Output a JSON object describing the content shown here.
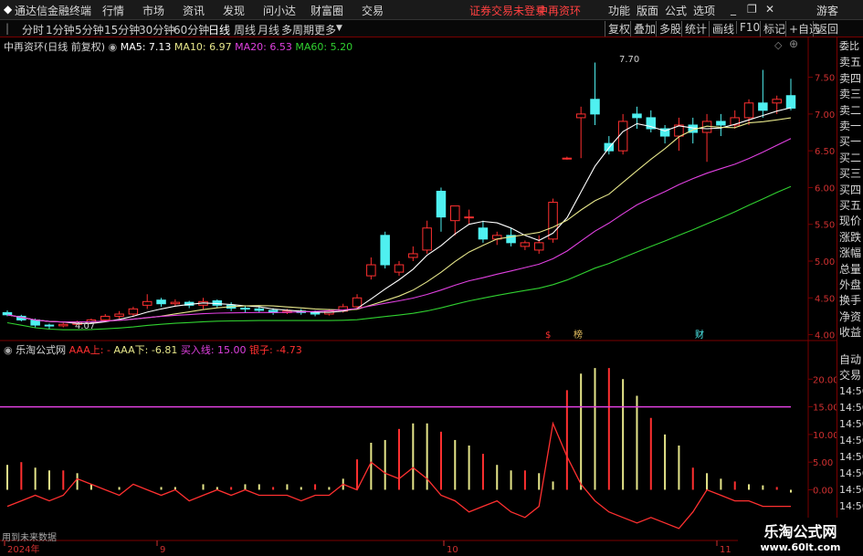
{
  "app": {
    "title": "通达信金融终端",
    "username": "游客",
    "status": "证券交易未登录",
    "stock_name": "中再资环"
  },
  "menu": [
    "行情",
    "市场",
    "资讯",
    "发现",
    "问小达",
    "财富圈",
    "交易"
  ],
  "menu_right": [
    "功能",
    "版面",
    "公式",
    "选项"
  ],
  "periods": {
    "items": [
      "分时",
      "1分钟",
      "5分钟",
      "15分钟",
      "30分钟",
      "60分钟",
      "日线",
      "周线",
      "月线",
      "多周期",
      "更多"
    ],
    "active": "日线"
  },
  "toolbar_right": [
    "复权",
    "叠加",
    "多股",
    "统计",
    "画线",
    "F10",
    "标记",
    "+自选",
    "返回"
  ],
  "main_chart": {
    "title": "中再资环(日线 前复权)",
    "ma": [
      {
        "label": "MA5: 7.13",
        "color": "#ffffff"
      },
      {
        "label": "MA10: 6.97",
        "color": "#e6e68a"
      },
      {
        "label": "MA20: 6.53",
        "color": "#e040e0"
      },
      {
        "label": "MA60: 5.20",
        "color": "#30d030"
      }
    ],
    "y_ticks": [
      "7.50",
      "7.00",
      "6.50",
      "6.00",
      "5.50",
      "5.00",
      "4.50",
      "4.00"
    ],
    "high_label": "7.70",
    "low_label": "4.07",
    "event_marks": [
      "$",
      "榜",
      "财"
    ]
  },
  "indicator": {
    "name": "乐淘公式网",
    "params": [
      {
        "label": "AAA上: -",
        "color": "#ff3030"
      },
      {
        "label": "AAA下: -6.81",
        "color": "#e6e68a"
      },
      {
        "label": "买入线: 15.00",
        "color": "#e040e0"
      },
      {
        "label": "银子: -4.73",
        "color": "#ff3030"
      }
    ],
    "y_ticks": [
      "20.00",
      "15.00",
      "10.00",
      "5.00",
      "0.00"
    ],
    "bottom_note": "用到未来数据"
  },
  "x_axis": [
    "2024年",
    "9",
    "10",
    "11"
  ],
  "right_panel": {
    "top": [
      "委比",
      "卖五",
      "卖四",
      "卖三",
      "卖二",
      "卖一",
      "买一",
      "买二",
      "买三",
      "买四",
      "买五",
      "现价",
      "涨跌",
      "涨幅",
      "总量",
      "外盘",
      "换手",
      "净资",
      "收益"
    ],
    "bottom_header": [
      "自动",
      "交易"
    ],
    "times": [
      "14:56",
      "14:56",
      "14:56",
      "14:56",
      "14:56",
      "14:56",
      "14:56",
      "14:56"
    ]
  },
  "watermark": {
    "name": "乐淘公式网",
    "url": "www.60lt.com"
  },
  "colors": {
    "up": "#ff3030",
    "down": "#4ff0f0",
    "ma5": "#ffffff",
    "ma10": "#e6e68a",
    "ma20": "#e040e0",
    "ma60": "#30d030",
    "grid": "#7a0000"
  },
  "chart_data": {
    "type": "candlestick",
    "candles": [
      [
        4.3,
        4.27,
        4.33,
        4.25
      ],
      [
        4.25,
        4.2,
        4.27,
        4.18
      ],
      [
        4.2,
        4.13,
        4.22,
        4.1
      ],
      [
        4.13,
        4.12,
        4.15,
        4.07
      ],
      [
        4.12,
        4.14,
        4.16,
        4.1
      ],
      [
        4.14,
        4.17,
        4.19,
        4.13
      ],
      [
        4.17,
        4.2,
        4.22,
        4.15
      ],
      [
        4.2,
        4.25,
        4.28,
        4.18
      ],
      [
        4.25,
        4.28,
        4.32,
        4.22
      ],
      [
        4.28,
        4.35,
        4.38,
        4.25
      ],
      [
        4.4,
        4.45,
        4.55,
        4.35
      ],
      [
        4.47,
        4.42,
        4.5,
        4.38
      ],
      [
        4.42,
        4.44,
        4.48,
        4.38
      ],
      [
        4.44,
        4.4,
        4.46,
        4.36
      ],
      [
        4.4,
        4.45,
        4.5,
        4.35
      ],
      [
        4.46,
        4.4,
        4.48,
        4.36
      ],
      [
        4.4,
        4.36,
        4.44,
        4.32
      ],
      [
        4.36,
        4.35,
        4.4,
        4.3
      ],
      [
        4.35,
        4.33,
        4.38,
        4.3
      ],
      [
        4.33,
        4.3,
        4.36,
        4.27
      ],
      [
        4.3,
        4.32,
        4.35,
        4.28
      ],
      [
        4.32,
        4.3,
        4.35,
        4.27
      ],
      [
        4.3,
        4.28,
        4.33,
        4.25
      ],
      [
        4.28,
        4.32,
        4.35,
        4.26
      ],
      [
        4.32,
        4.38,
        4.42,
        4.3
      ],
      [
        4.38,
        4.5,
        4.55,
        4.36
      ],
      [
        4.8,
        4.95,
        5.05,
        4.75
      ],
      [
        5.35,
        4.95,
        5.4,
        4.9
      ],
      [
        4.85,
        4.95,
        5.0,
        4.8
      ],
      [
        5.05,
        5.1,
        5.2,
        5.0
      ],
      [
        5.15,
        5.45,
        5.55,
        5.1
      ],
      [
        5.95,
        5.6,
        6.0,
        5.4
      ],
      [
        5.55,
        5.75,
        5.75,
        5.35
      ],
      [
        5.6,
        5.6,
        5.7,
        5.5
      ],
      [
        5.45,
        5.3,
        5.55,
        5.25
      ],
      [
        5.3,
        5.35,
        5.4,
        5.22
      ],
      [
        5.35,
        5.25,
        5.45,
        5.2
      ],
      [
        5.2,
        5.25,
        5.28,
        5.15
      ],
      [
        5.15,
        5.25,
        5.35,
        5.1
      ],
      [
        5.3,
        5.8,
        5.85,
        5.25
      ],
      [
        6.4,
        6.4,
        6.42,
        6.38
      ],
      [
        6.95,
        7.0,
        7.1,
        6.4
      ],
      [
        7.2,
        7.0,
        7.7,
        6.85
      ],
      [
        6.6,
        6.5,
        6.7,
        6.45
      ],
      [
        6.5,
        6.9,
        7.0,
        6.45
      ],
      [
        7.0,
        6.95,
        7.1,
        6.8
      ],
      [
        6.95,
        6.8,
        7.05,
        6.75
      ],
      [
        6.8,
        6.7,
        6.85,
        6.6
      ],
      [
        6.7,
        6.85,
        6.95,
        6.5
      ],
      [
        6.85,
        6.75,
        6.95,
        6.6
      ],
      [
        6.75,
        6.9,
        7.0,
        6.35
      ],
      [
        6.9,
        6.85,
        7.0,
        6.7
      ],
      [
        6.85,
        6.95,
        7.05,
        6.8
      ],
      [
        6.95,
        7.15,
        7.2,
        6.85
      ],
      [
        7.15,
        7.05,
        7.6,
        6.95
      ],
      [
        7.15,
        7.2,
        7.25,
        7.0
      ],
      [
        7.25,
        7.08,
        7.48,
        7.05
      ]
    ],
    "indicator_lines": {
      "yinzi": [
        -3,
        -2,
        -1,
        -2,
        -1,
        2,
        1,
        0,
        -1,
        1,
        0,
        -1,
        0,
        -2,
        -1,
        0,
        -1,
        0,
        -1,
        -1,
        -1,
        -2,
        -1,
        -1,
        1,
        0,
        5,
        3,
        2,
        4,
        2,
        -1,
        -2,
        -4,
        -3,
        -2,
        -4,
        -5,
        -3,
        12,
        6,
        1,
        -2,
        -4,
        -5,
        -6,
        -5,
        -6,
        -7,
        -4,
        0,
        -1,
        -2,
        -2,
        -3,
        -3,
        -3
      ],
      "aaa_bars": [
        4.5,
        5,
        4,
        3.5,
        3.5,
        3,
        1,
        0,
        0.5,
        0,
        0,
        0.5,
        0.5,
        0,
        1,
        0.5,
        0.5,
        1,
        1,
        0.5,
        1,
        0.5,
        1,
        0.5,
        2,
        5.5,
        8.5,
        9,
        11,
        12,
        12,
        10.5,
        9,
        8,
        6.5,
        4.5,
        3.5,
        3.5,
        3,
        1.5,
        18,
        21,
        22,
        22,
        20,
        17,
        13,
        10,
        8,
        4,
        3,
        2,
        1.5,
        1,
        0.8,
        0.5,
        -0.5
      ],
      "buy_line": 15
    }
  }
}
